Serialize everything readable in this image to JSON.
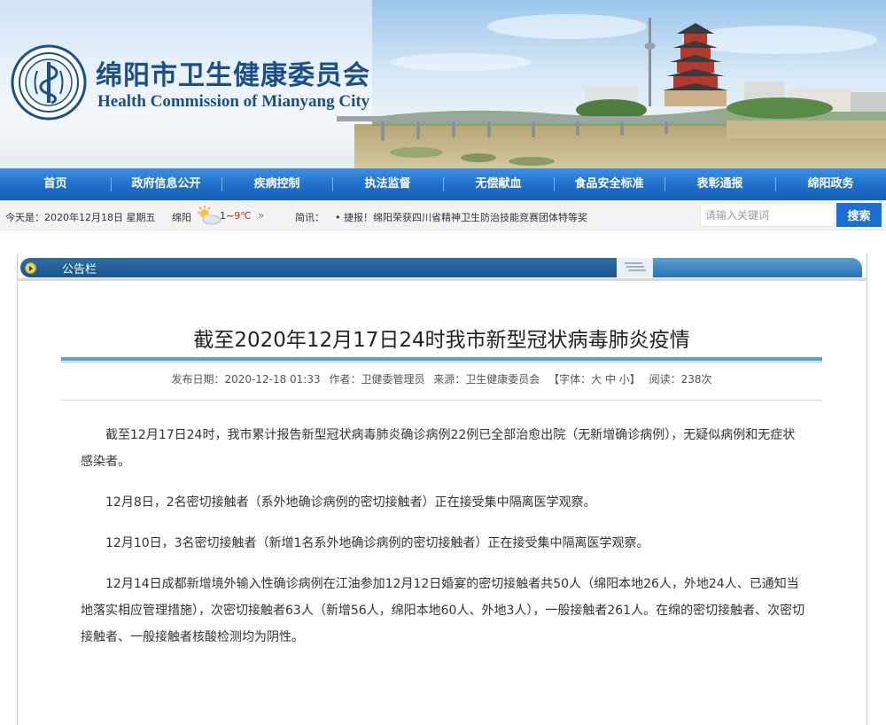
{
  "header": {
    "title_cn": "绵阳市卫生健康委员会",
    "title_en": "Health Commission of Mianyang City",
    "logo_icon": "medical-staff-seal-icon"
  },
  "nav": {
    "items": [
      {
        "label": "首页"
      },
      {
        "label": "政府信息公开"
      },
      {
        "label": "疾病控制"
      },
      {
        "label": "执法监督"
      },
      {
        "label": "无偿献血"
      },
      {
        "label": "食品安全标准"
      },
      {
        "label": "表彰通报"
      },
      {
        "label": "绵阳政务"
      }
    ]
  },
  "infobar": {
    "date": "今天是：2020年12月18日  星期五",
    "city": "绵阳",
    "weather_icon": "sun-cloud-icon",
    "temp_low": "1~",
    "temp_high": "9℃",
    "more": "»",
    "brief_label": "简讯：",
    "brief_text": "• 捷报！绵阳荣获四川省精神卫生防治技能竞赛团体特等奖",
    "search_placeholder": "请输入关键词",
    "search_button": "搜索"
  },
  "panel": {
    "title": "公告栏"
  },
  "article": {
    "title": "截至2020年12月17日24时我市新型冠状病毒肺炎疫情",
    "meta": {
      "date": "发布日期：2020-12-18 01:33",
      "author": "作者：卫健委管理员",
      "source": "来源：卫生健康委员会",
      "font_size": "【字体：大 中 小】",
      "views": "阅读：238次"
    },
    "paragraphs": [
      "截至12月17日24时，我市累计报告新型冠状病毒肺炎确诊病例22例已全部治愈出院（无新增确诊病例），无疑似病例和无症状感染者。",
      "12月8日，2名密切接触者（系外地确诊病例的密切接触者）正在接受集中隔离医学观察。",
      "12月10日，3名密切接触者（新增1名系外地确诊病例的密切接触者）正在接受集中隔离医学观察。",
      "12月14日成都新增境外输入性确诊病例在江油参加12月12日婚宴的密切接触者共50人（绵阳本地26人，外地24人、已通知当地落实相应管理措施），次密切接触者63人（新增56人，绵阳本地60人、外地3人），一般接触者261人。在绵的密切接触者、次密切接触者、一般接触者核酸检测均为阴性。"
    ]
  },
  "colors": {
    "nav_blue": "#1f6fc9",
    "title_blue": "#1b4f8a",
    "search_blue": "#1a6fd0",
    "temp_red": "#d9261c"
  }
}
